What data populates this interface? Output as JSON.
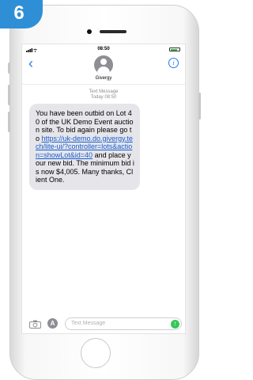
{
  "step": {
    "number": "6"
  },
  "status_bar": {
    "time": "08:50"
  },
  "header": {
    "back_glyph": "‹",
    "contact_name": "Givergy",
    "info_glyph": "i"
  },
  "thread": {
    "label": "Text Message",
    "timestamp": "Today 08:50"
  },
  "message": {
    "before": "You have been outbid on Lot 40 of the UK Demo Event auction site. To bid again please go to ",
    "link": "https://uk-demo.do.givergy.tech/lite-ui/?controller=lots&action=showLot&id=40",
    "after": " and place your new bid. The minimum bid is now $4,005. Many thanks, Client One."
  },
  "composer": {
    "placeholder": "Text Message",
    "app_glyph": "A",
    "send_glyph": "↑"
  },
  "colors": {
    "badge": "#2f8fd6",
    "link": "#1a5fd0",
    "bubble": "#e5e5ea",
    "accent": "#1e7cf2",
    "send": "#34c759"
  },
  "icons": [
    "wifi-icon",
    "signal-icon",
    "battery-icon",
    "back-chevron-icon",
    "avatar-icon",
    "info-icon",
    "camera-icon",
    "app-store-icon",
    "send-icon"
  ]
}
